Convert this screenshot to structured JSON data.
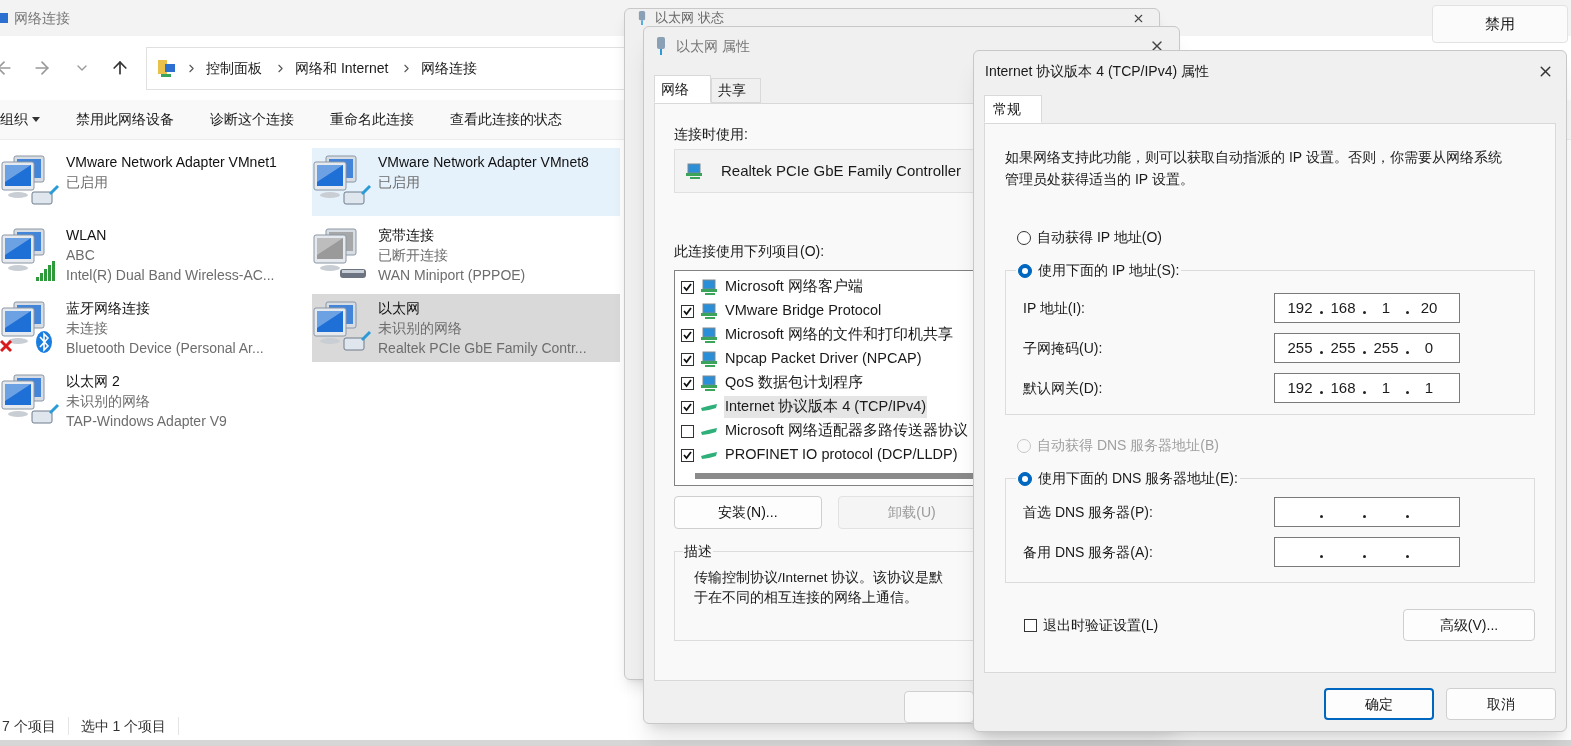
{
  "explorer": {
    "title": "网络连接",
    "breadcrumb": [
      "控制面板",
      "网络和 Internet",
      "网络连接"
    ],
    "toolbar": [
      {
        "label": "组织",
        "dropdown": true
      },
      {
        "label": "禁用此网络设备",
        "dropdown": false
      },
      {
        "label": "诊断这个连接",
        "dropdown": false
      },
      {
        "label": "重命名此连接",
        "dropdown": false
      },
      {
        "label": "查看此连接的状态",
        "dropdown": false
      }
    ],
    "adapters": [
      {
        "name": "VMware Network Adapter VMnet1",
        "status": "已启用",
        "kind": "cable",
        "highlighted": false,
        "selected": false
      },
      {
        "name": "VMware Network Adapter VMnet8",
        "status": "已启用",
        "kind": "cable",
        "highlighted": true,
        "selected": false
      },
      {
        "name": "WLAN",
        "status": "ABC",
        "device": "Intel(R) Dual Band Wireless-AC...",
        "kind": "signal",
        "highlighted": false,
        "selected": false
      },
      {
        "name": "宽带连接",
        "status": "已断开连接",
        "device": "WAN Miniport (PPPOE)",
        "kind": "modem",
        "highlighted": false,
        "selected": false
      },
      {
        "name": "蓝牙网络连接",
        "status": "未连接",
        "device": "Bluetooth Device (Personal Ar...",
        "kind": "bluetooth",
        "highlighted": false,
        "selected": false
      },
      {
        "name": "以太网",
        "status": "未识别的网络",
        "device": "Realtek PCIe GbE Family Contr...",
        "kind": "cable",
        "highlighted": false,
        "selected": true
      },
      {
        "name": "以太网 2",
        "status": "未识别的网络",
        "device": "TAP-Windows Adapter V9",
        "kind": "cable",
        "highlighted": false,
        "selected": false
      }
    ],
    "status_bar": [
      "7 个项目",
      "选中 1 个项目"
    ],
    "side_button": "禁用"
  },
  "status_dialog": {
    "title": "以太网 状态"
  },
  "properties_dialog": {
    "title": "以太网 属性",
    "tabs": [
      {
        "label": "网络",
        "selected": true
      },
      {
        "label": "共享",
        "selected": false
      }
    ],
    "connect_using_label": "连接时使用:",
    "adapter": "Realtek PCIe GbE Family Controller",
    "items_label": "此连接使用下列项目(O):",
    "items": [
      {
        "label": "Microsoft 网络客户端",
        "checked": true,
        "selected": false,
        "kind": "client"
      },
      {
        "label": "VMware Bridge Protocol",
        "checked": true,
        "selected": false,
        "kind": "client"
      },
      {
        "label": "Microsoft 网络的文件和打印机共享",
        "checked": true,
        "selected": false,
        "kind": "client"
      },
      {
        "label": "Npcap Packet Driver (NPCAP)",
        "checked": true,
        "selected": false,
        "kind": "client"
      },
      {
        "label": "QoS 数据包计划程序",
        "checked": true,
        "selected": false,
        "kind": "client"
      },
      {
        "label": "Internet 协议版本 4 (TCP/IPv4)",
        "checked": true,
        "selected": true,
        "kind": "protocol"
      },
      {
        "label": "Microsoft 网络适配器多路传送器协议",
        "checked": false,
        "selected": false,
        "kind": "protocol"
      },
      {
        "label": "PROFINET IO protocol (DCP/LLDP)",
        "checked": true,
        "selected": false,
        "kind": "protocol"
      }
    ],
    "buttons": [
      {
        "label": "安装(N)...",
        "disabled": false
      },
      {
        "label": "卸载(U)",
        "disabled": true
      }
    ],
    "description_label": "描述",
    "description": [
      "传输控制协议/Internet 协议。该协议是默",
      "于在不同的相互连接的网络上通信。"
    ]
  },
  "ipv4_dialog": {
    "title": "Internet 协议版本 4 (TCP/IPv4) 属性",
    "tabs": [
      {
        "label": "常规",
        "selected": true
      }
    ],
    "intro": "如果网络支持此功能，则可以获取自动指派的 IP 设置。否则，你需要从网络系统管理员处获得适当的 IP 设置。",
    "ip_radios": [
      {
        "label": "自动获得 IP 地址(O)",
        "selected": false,
        "disabled": false
      },
      {
        "label": "使用下面的 IP 地址(S):",
        "selected": true,
        "disabled": false
      }
    ],
    "ip_fields": [
      {
        "label": "IP 地址(I):",
        "octets": [
          "192",
          "168",
          "1",
          "20"
        ]
      },
      {
        "label": "子网掩码(U):",
        "octets": [
          "255",
          "255",
          "255",
          "0"
        ]
      },
      {
        "label": "默认网关(D):",
        "octets": [
          "192",
          "168",
          "1",
          "1"
        ]
      }
    ],
    "dns_radios": [
      {
        "label": "自动获得 DNS 服务器地址(B)",
        "selected": false,
        "disabled": true
      },
      {
        "label": "使用下面的 DNS 服务器地址(E):",
        "selected": true,
        "disabled": false
      }
    ],
    "dns_fields": [
      {
        "label": "首选 DNS 服务器(P):"
      },
      {
        "label": "备用 DNS 服务器(A):"
      }
    ],
    "validate": {
      "label": "退出时验证设置(L)",
      "checked": false
    },
    "advanced_button": "高级(V)...",
    "ok_button": "确定",
    "cancel_button": "取消"
  }
}
